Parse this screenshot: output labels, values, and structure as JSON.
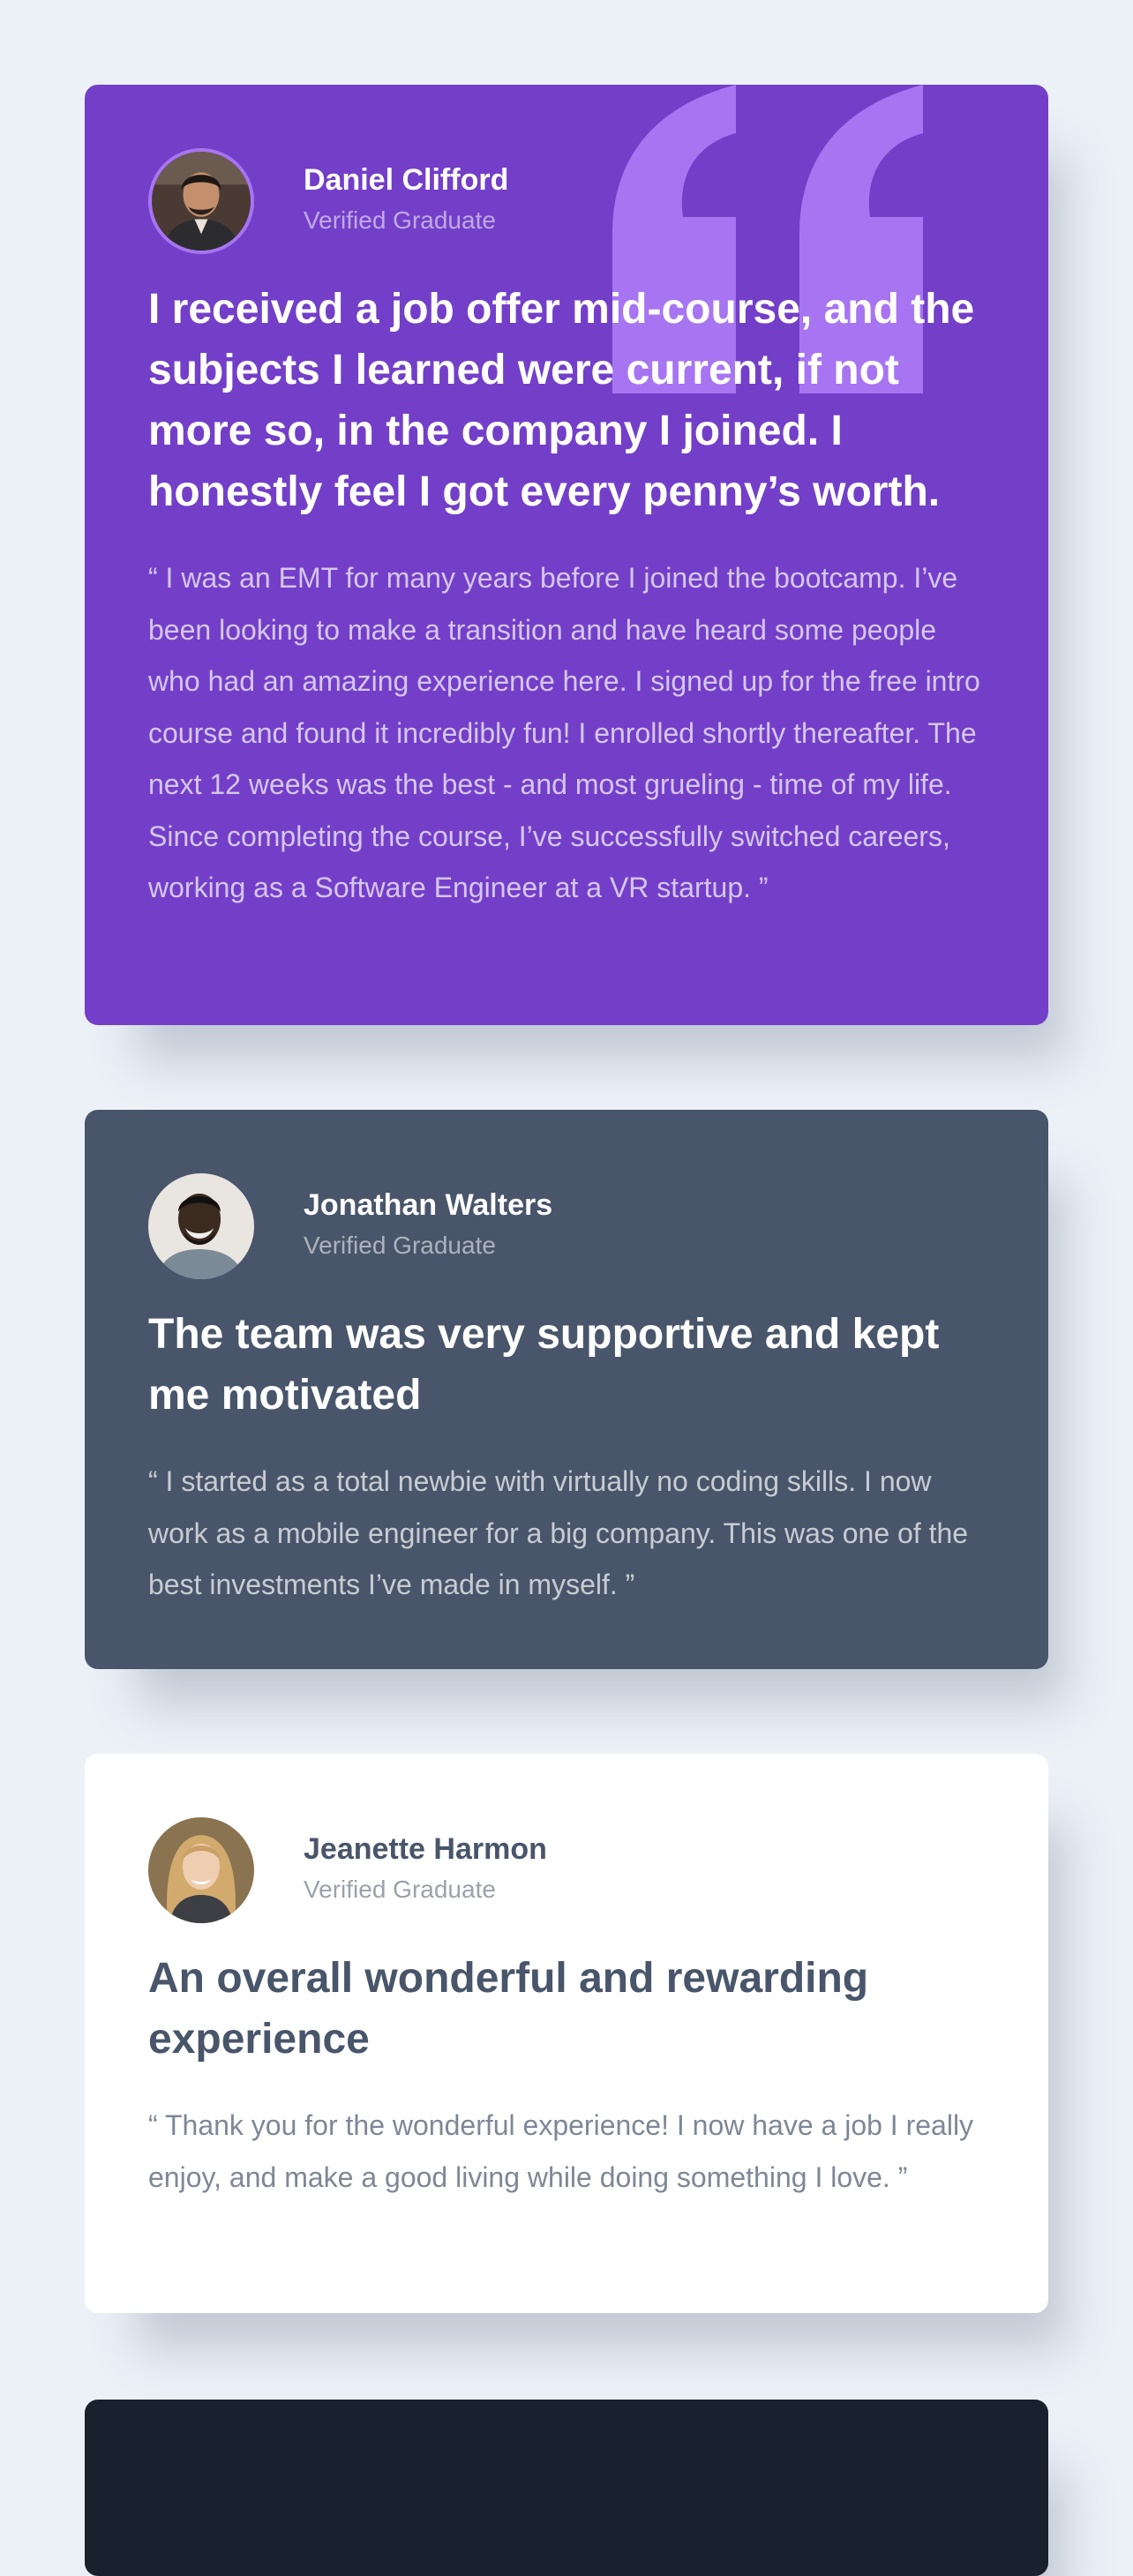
{
  "colors": {
    "page_background": "#ecf1f8",
    "purple_card": "#733fc8",
    "slate_card": "#48556a",
    "white_card": "#ffffff",
    "dark_card": "#19212e",
    "quote_mark": "#a775f1"
  },
  "testimonials": [
    {
      "name": "Daniel Clifford",
      "role": "Verified Graduate",
      "headline": "I received a job offer mid-course, and the subjects I learned were current, if not more so, in the company I joined. I honestly feel I got every penny’s worth.",
      "quote": "“ I was an EMT for many years before I joined the bootcamp. I’ve been looking to make a transition and have heard some people who had an amazing experience here. I signed up for the free intro course and found it incredibly fun! I enrolled shortly thereafter. The next 12 weeks was the best - and most grueling - time of my life. Since completing the course, I’ve successfully switched careers, working as a Software Engineer at a VR startup. ”",
      "decoration_icon": "quotation-mark-icon"
    },
    {
      "name": "Jonathan Walters",
      "role": "Verified Graduate",
      "headline": "The team was very supportive and kept me motivated",
      "quote": "“ I started as a total newbie with virtually no coding skills. I now work as a mobile engineer for a big company. This was one of the best investments I’ve made in myself. ”"
    },
    {
      "name": "Jeanette Harmon",
      "role": "Verified Graduate",
      "headline": "An overall wonderful and rewarding experience",
      "quote": "“ Thank you for the wonderful experience! I now have a job I really enjoy, and make a good living while doing something I love. ”"
    }
  ]
}
